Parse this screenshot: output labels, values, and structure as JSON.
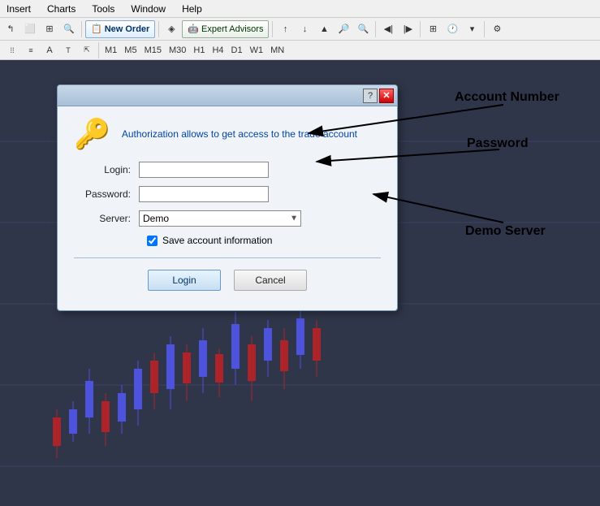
{
  "menubar": {
    "items": [
      "Insert",
      "Charts",
      "Tools",
      "Window",
      "Help"
    ]
  },
  "toolbar1": {
    "new_order_label": "New Order",
    "expert_advisors_label": "Expert Advisors"
  },
  "toolbar2": {
    "timeframes": [
      "M1",
      "M5",
      "M15",
      "M30",
      "H1",
      "H4",
      "D1",
      "W1",
      "MN"
    ]
  },
  "dialog": {
    "help_btn_label": "?",
    "close_btn_label": "✕",
    "info_text": "Authorization allows to get access to the trade account",
    "login_label": "Login:",
    "login_value": "",
    "password_label": "Password:",
    "password_value": "",
    "server_label": "Server:",
    "server_value": "Demo",
    "checkbox_label": "Save account information",
    "login_btn": "Login",
    "cancel_btn": "Cancel"
  },
  "annotations": {
    "account_number_label": "Account Number",
    "password_label": "Password",
    "demo_server_label": "Demo Server"
  }
}
